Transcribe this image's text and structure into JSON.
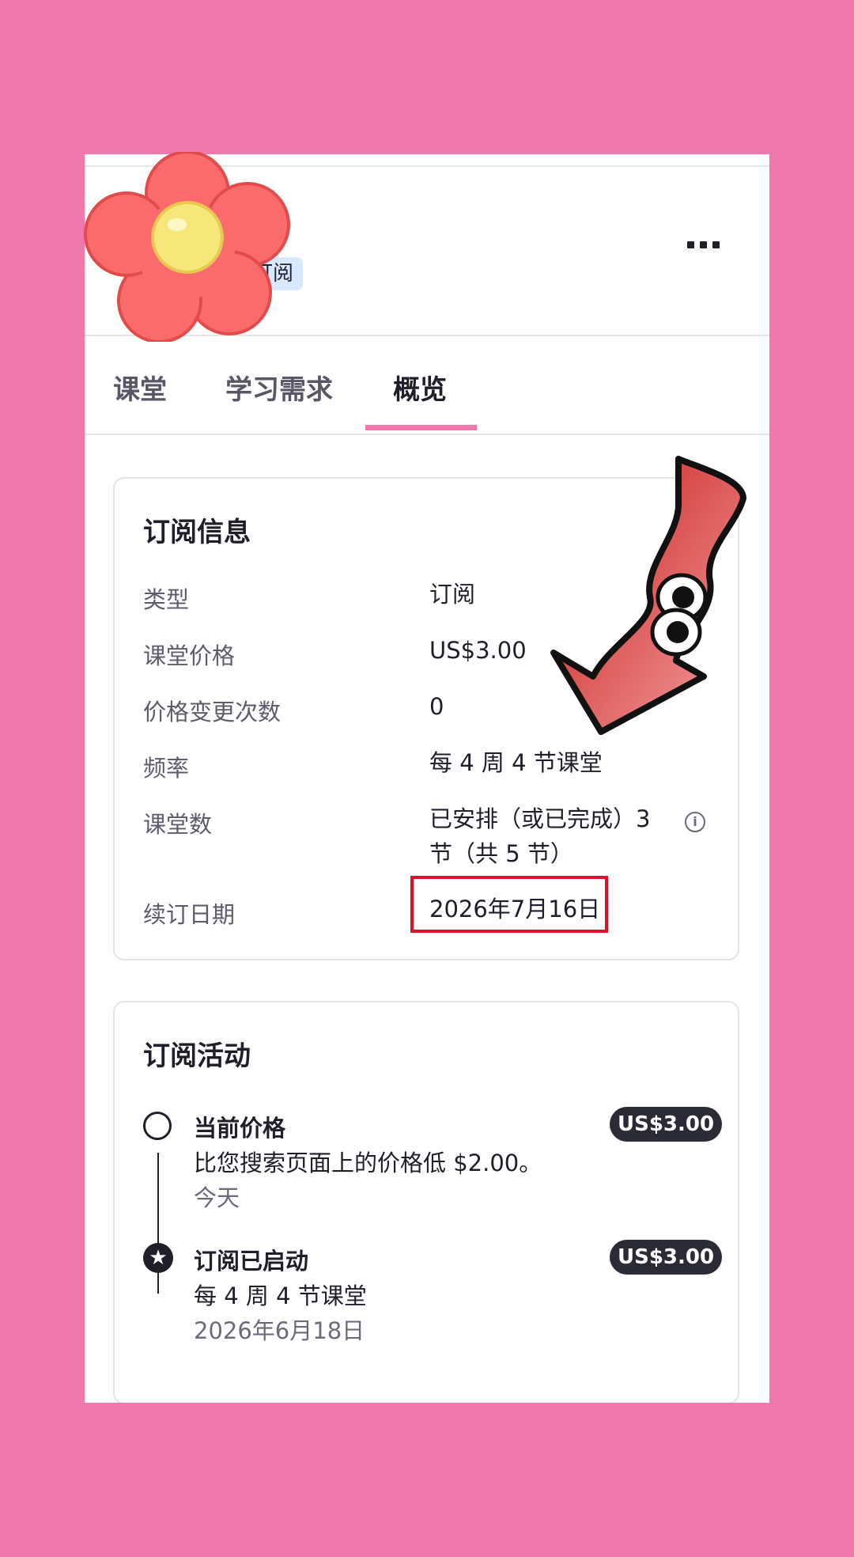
{
  "header": {
    "title": "...",
    "badge": "订阅",
    "more_label": "更多"
  },
  "tabs": [
    {
      "label": "课堂"
    },
    {
      "label": "学习需求"
    },
    {
      "label": "概览"
    }
  ],
  "subscription_info": {
    "title": "订阅信息",
    "rows": [
      {
        "label": "类型",
        "value": "订阅"
      },
      {
        "label": "课堂价格",
        "value": "US$3.00"
      },
      {
        "label": "价格变更次数",
        "value": "0"
      },
      {
        "label": "频率",
        "value": "每 4 周 4 节课堂"
      },
      {
        "label": "课堂数",
        "value": "已安排（或已完成）3 节（共 5 节）"
      },
      {
        "label": "续订日期",
        "value": "2026年7月16日"
      }
    ]
  },
  "subscription_activity": {
    "title": "订阅活动",
    "items": [
      {
        "title": "当前价格",
        "desc": "比您搜索页面上的价格低 $2.00。",
        "date": "今天",
        "price": "US$3.00"
      },
      {
        "title": "订阅已启动",
        "desc": "每 4 周 4 节课堂",
        "date": "2026年6月18日",
        "price": "US$3.00"
      }
    ]
  },
  "colors": {
    "background": "#f178ad",
    "tab_accent": "#f178ad",
    "highlight": "#d7152d",
    "badge_bg": "#d7e8ff",
    "price_badge_bg": "#2b2b36"
  },
  "icons": {
    "more": "more-dots-icon",
    "info": "info-icon",
    "timeline_open": "circle-outline-icon",
    "timeline_start": "star-icon"
  }
}
